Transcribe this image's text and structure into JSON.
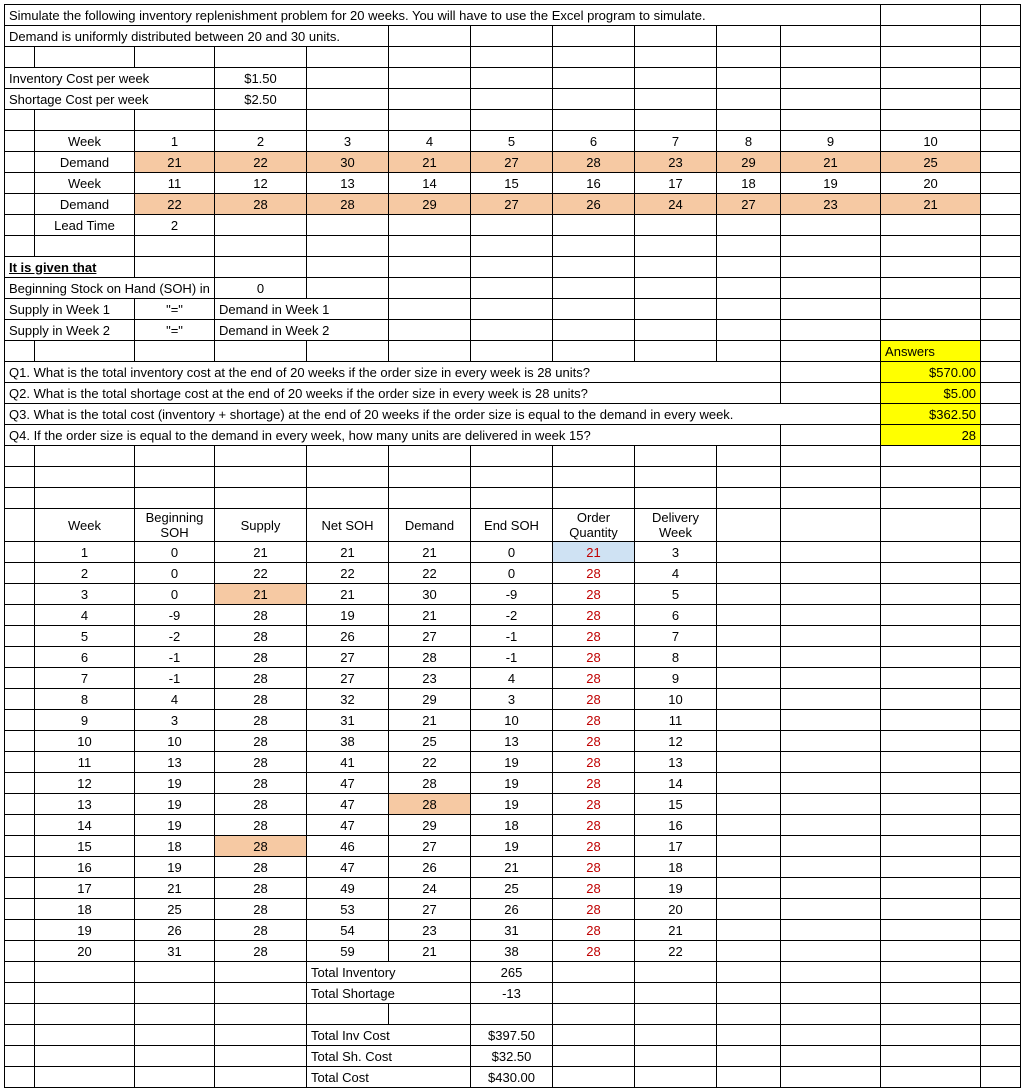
{
  "intro1": "Simulate the following inventory replenishment problem for 20 weeks. You will have to use the Excel program to simulate.",
  "intro2": "Demand is uniformly distributed between 20 and 30 units.",
  "labels": {
    "invCost": "Inventory Cost per week",
    "invCostVal": "$1.50",
    "shCost": "Shortage Cost per week",
    "shCostVal": "$2.50",
    "week": "Week",
    "demand": "Demand",
    "leadTime": "Lead Time",
    "leadTimeVal": "2",
    "itGiven": "It is given that",
    "begSOH": "Beginning Stock on Hand (SOH) in",
    "begSOHVal": "0",
    "supW1": "Supply in Week 1",
    "supW2": "Supply in Week 2",
    "eq": "\"=\"",
    "dW1": "Demand in Week 1",
    "dW2": "Demand in Week 2",
    "answers": "Answers",
    "q1": "Q1. What is the total inventory cost at the end of 20 weeks if the order size in every week is 28 units?",
    "q2": "Q2. What is the total shortage cost at the end of 20 weeks if the order size in every week is 28 units?",
    "q3": "Q3. What is the total cost (inventory + shortage) at the end of 20 weeks if the order size is equal to the demand in every week.",
    "q4": "Q4. If the order size is equal to the demand in every week, how many units are delivered in week 15?",
    "a1": "$570.00",
    "a2": "$5.00",
    "a3": "$362.50",
    "a4": "28",
    "colWeek": "Week",
    "colBegSOH": "Beginning SOH",
    "colBegSOH_l1": "Beginning",
    "colBegSOH_l2": "SOH",
    "colSupply": "Supply",
    "colNetSOH": "Net SOH",
    "colDemand": "Demand",
    "colEndSOH": "End SOH",
    "colOrderQ": "Order Quantity",
    "colOrderQ_l1": "Order",
    "colOrderQ_l2": "Quantity",
    "colDelW": "Delivery Week",
    "colDelW_l1": "Delivery",
    "colDelW_l2": "Week",
    "totInv": "Total Inventory",
    "totSh": "Total Shortage",
    "totInvCost": "Total Inv Cost",
    "totShCost": "Total Sh. Cost",
    "totCost": "Total Cost",
    "totInvVal": "265",
    "totShVal": "-13",
    "totInvCostVal": "$397.50",
    "totShCostVal": "$32.50",
    "totCostVal": "$430.00"
  },
  "weekRow1": [
    "1",
    "2",
    "3",
    "4",
    "5",
    "6",
    "7",
    "8",
    "9",
    "10"
  ],
  "demRow1": [
    "21",
    "22",
    "30",
    "21",
    "27",
    "28",
    "23",
    "29",
    "21",
    "25"
  ],
  "weekRow2": [
    "11",
    "12",
    "13",
    "14",
    "15",
    "16",
    "17",
    "18",
    "19",
    "20"
  ],
  "demRow2": [
    "22",
    "28",
    "28",
    "29",
    "27",
    "26",
    "24",
    "27",
    "23",
    "21"
  ],
  "sim": [
    {
      "w": "1",
      "bsoh": "0",
      "sup": "21",
      "net": "21",
      "dem": "21",
      "end": "0",
      "oq": "21",
      "dw": "3",
      "supHi": false,
      "demHi": false,
      "oqBlue": true
    },
    {
      "w": "2",
      "bsoh": "0",
      "sup": "22",
      "net": "22",
      "dem": "22",
      "end": "0",
      "oq": "28",
      "dw": "4",
      "supHi": false,
      "demHi": false,
      "oqBlue": false
    },
    {
      "w": "3",
      "bsoh": "0",
      "sup": "21",
      "net": "21",
      "dem": "30",
      "end": "-9",
      "oq": "28",
      "dw": "5",
      "supHi": true,
      "demHi": false,
      "oqBlue": false
    },
    {
      "w": "4",
      "bsoh": "-9",
      "sup": "28",
      "net": "19",
      "dem": "21",
      "end": "-2",
      "oq": "28",
      "dw": "6",
      "supHi": false,
      "demHi": false,
      "oqBlue": false
    },
    {
      "w": "5",
      "bsoh": "-2",
      "sup": "28",
      "net": "26",
      "dem": "27",
      "end": "-1",
      "oq": "28",
      "dw": "7",
      "supHi": false,
      "demHi": false,
      "oqBlue": false
    },
    {
      "w": "6",
      "bsoh": "-1",
      "sup": "28",
      "net": "27",
      "dem": "28",
      "end": "-1",
      "oq": "28",
      "dw": "8",
      "supHi": false,
      "demHi": false,
      "oqBlue": false
    },
    {
      "w": "7",
      "bsoh": "-1",
      "sup": "28",
      "net": "27",
      "dem": "23",
      "end": "4",
      "oq": "28",
      "dw": "9",
      "supHi": false,
      "demHi": false,
      "oqBlue": false
    },
    {
      "w": "8",
      "bsoh": "4",
      "sup": "28",
      "net": "32",
      "dem": "29",
      "end": "3",
      "oq": "28",
      "dw": "10",
      "supHi": false,
      "demHi": false,
      "oqBlue": false
    },
    {
      "w": "9",
      "bsoh": "3",
      "sup": "28",
      "net": "31",
      "dem": "21",
      "end": "10",
      "oq": "28",
      "dw": "11",
      "supHi": false,
      "demHi": false,
      "oqBlue": false
    },
    {
      "w": "10",
      "bsoh": "10",
      "sup": "28",
      "net": "38",
      "dem": "25",
      "end": "13",
      "oq": "28",
      "dw": "12",
      "supHi": false,
      "demHi": false,
      "oqBlue": false
    },
    {
      "w": "11",
      "bsoh": "13",
      "sup": "28",
      "net": "41",
      "dem": "22",
      "end": "19",
      "oq": "28",
      "dw": "13",
      "supHi": false,
      "demHi": false,
      "oqBlue": false
    },
    {
      "w": "12",
      "bsoh": "19",
      "sup": "28",
      "net": "47",
      "dem": "28",
      "end": "19",
      "oq": "28",
      "dw": "14",
      "supHi": false,
      "demHi": false,
      "oqBlue": false
    },
    {
      "w": "13",
      "bsoh": "19",
      "sup": "28",
      "net": "47",
      "dem": "28",
      "end": "19",
      "oq": "28",
      "dw": "15",
      "supHi": false,
      "demHi": true,
      "oqBlue": false
    },
    {
      "w": "14",
      "bsoh": "19",
      "sup": "28",
      "net": "47",
      "dem": "29",
      "end": "18",
      "oq": "28",
      "dw": "16",
      "supHi": false,
      "demHi": false,
      "oqBlue": false
    },
    {
      "w": "15",
      "bsoh": "18",
      "sup": "28",
      "net": "46",
      "dem": "27",
      "end": "19",
      "oq": "28",
      "dw": "17",
      "supHi": true,
      "demHi": false,
      "oqBlue": false
    },
    {
      "w": "16",
      "bsoh": "19",
      "sup": "28",
      "net": "47",
      "dem": "26",
      "end": "21",
      "oq": "28",
      "dw": "18",
      "supHi": false,
      "demHi": false,
      "oqBlue": false
    },
    {
      "w": "17",
      "bsoh": "21",
      "sup": "28",
      "net": "49",
      "dem": "24",
      "end": "25",
      "oq": "28",
      "dw": "19",
      "supHi": false,
      "demHi": false,
      "oqBlue": false
    },
    {
      "w": "18",
      "bsoh": "25",
      "sup": "28",
      "net": "53",
      "dem": "27",
      "end": "26",
      "oq": "28",
      "dw": "20",
      "supHi": false,
      "demHi": false,
      "oqBlue": false
    },
    {
      "w": "19",
      "bsoh": "26",
      "sup": "28",
      "net": "54",
      "dem": "23",
      "end": "31",
      "oq": "28",
      "dw": "21",
      "supHi": false,
      "demHi": false,
      "oqBlue": false
    },
    {
      "w": "20",
      "bsoh": "31",
      "sup": "28",
      "net": "59",
      "dem": "21",
      "end": "38",
      "oq": "28",
      "dw": "22",
      "supHi": false,
      "demHi": false,
      "oqBlue": false
    }
  ]
}
